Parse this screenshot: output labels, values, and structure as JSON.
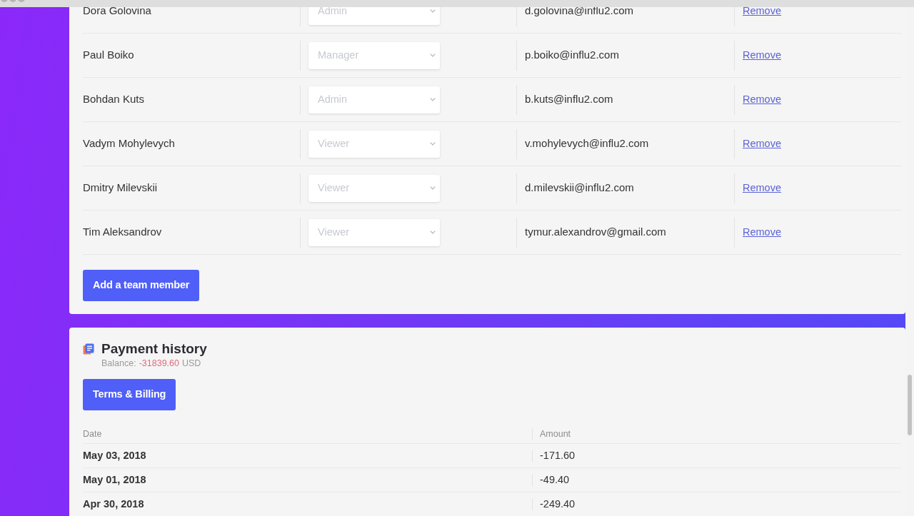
{
  "team_members": [
    {
      "name": "Dora Golovina",
      "role": "Admin",
      "disabled": true,
      "email": "d.golovina@influ2.com",
      "action": "Remove"
    },
    {
      "name": "Paul Boiko",
      "role": "Manager",
      "disabled": true,
      "email": "p.boiko@influ2.com",
      "action": "Remove"
    },
    {
      "name": "Bohdan Kuts",
      "role": "Admin",
      "disabled": true,
      "email": "b.kuts@influ2.com",
      "action": "Remove"
    },
    {
      "name": "Vadym Mohylevych",
      "role": "Viewer",
      "disabled": true,
      "email": "v.mohylevych@influ2.com",
      "action": "Remove"
    },
    {
      "name": "Dmitry Milevskii",
      "role": "Viewer",
      "disabled": true,
      "email": "d.milevskii@influ2.com",
      "action": "Remove"
    },
    {
      "name": "Tim Aleksandrov",
      "role": "Viewer",
      "disabled": true,
      "email": "tymur.alexandrov@gmail.com",
      "action": "Remove"
    }
  ],
  "add_member_button": "Add a team member",
  "payment_history": {
    "title": "Payment history",
    "balance_label": "Balance:",
    "balance_value": "-31839.60",
    "balance_currency": "USD",
    "terms_button": "Terms & Billing",
    "columns": [
      "Date",
      "Amount"
    ],
    "rows": [
      {
        "date": "May 03, 2018",
        "amount": "-171.60"
      },
      {
        "date": "May 01, 2018",
        "amount": "-49.40"
      },
      {
        "date": "Apr 30, 2018",
        "amount": "-249.40"
      }
    ]
  }
}
